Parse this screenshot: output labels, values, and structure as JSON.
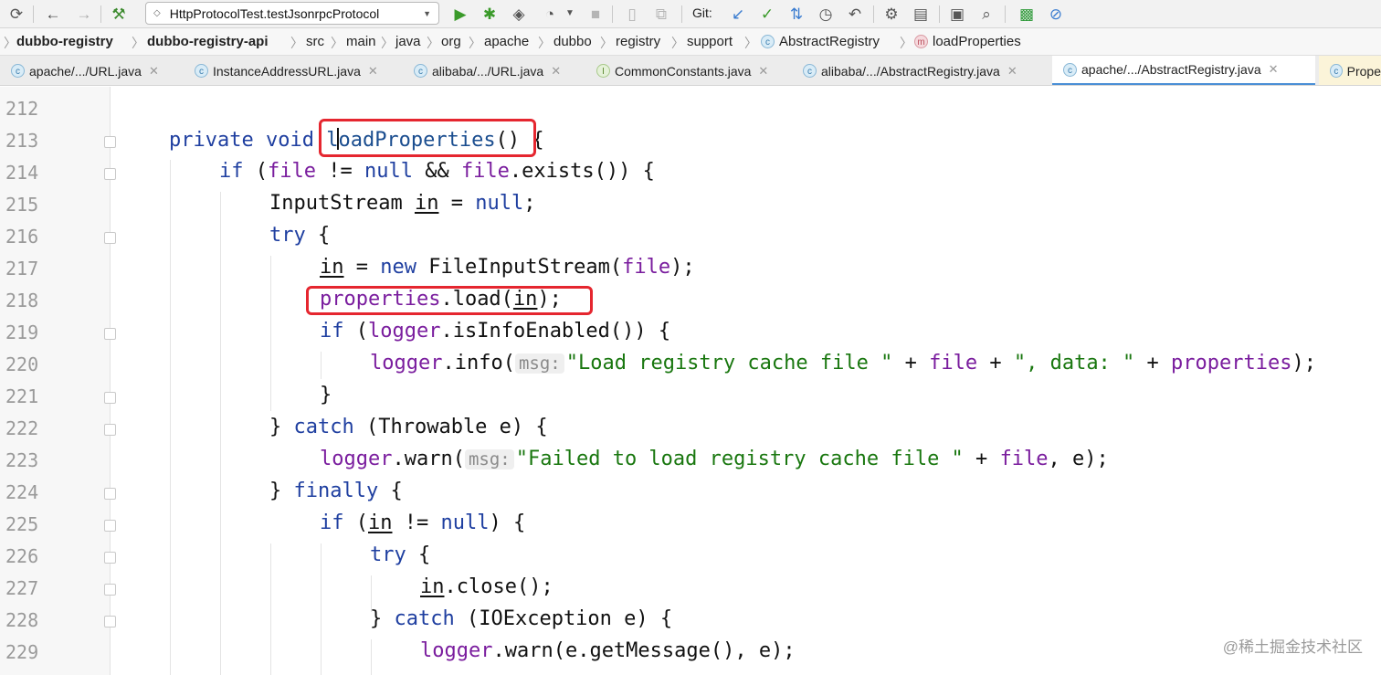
{
  "toolbar": {
    "run_config": "HttpProtocolTest.testJsonrpcProtocol",
    "git_label": "Git:"
  },
  "breadcrumb": {
    "items": [
      "dubbo-registry",
      "dubbo-registry-api",
      "src",
      "main",
      "java",
      "org",
      "apache",
      "dubbo",
      "registry",
      "support",
      "AbstractRegistry",
      "loadProperties"
    ]
  },
  "tabs": [
    {
      "label": "apache/.../URL.java",
      "icon": "c"
    },
    {
      "label": "InstanceAddressURL.java",
      "icon": "c"
    },
    {
      "label": "alibaba/.../URL.java",
      "icon": "c"
    },
    {
      "label": "CommonConstants.java",
      "icon": "i"
    },
    {
      "label": "alibaba/.../AbstractRegistry.java",
      "icon": "c"
    },
    {
      "label": "apache/.../AbstractRegistry.java",
      "icon": "c"
    },
    {
      "label": "Prope",
      "icon": "c"
    }
  ],
  "editor": {
    "line_numbers": [
      "212",
      "213",
      "214",
      "215",
      "216",
      "217",
      "218",
      "219",
      "220",
      "221",
      "222",
      "223",
      "224",
      "225",
      "226",
      "227",
      "228",
      "229"
    ],
    "hint_msg": "msg:",
    "tokens": {
      "private": "private",
      "void": "void",
      "method": "loadProperties",
      "method_tail": "()",
      "open_brace": " {",
      "if": "if",
      "file": "file",
      "neq_null": " != ",
      "null": "null",
      "and": " && ",
      "exists": ".exists()) {",
      "inputstream": "InputStream ",
      "in": "in",
      "eq": " = ",
      "semicolon": ";",
      "try": "try",
      "brace_open": " {",
      "new": "new",
      "fis": " FileInputStream(",
      "close_paren_semi": ");",
      "properties": "properties",
      "load": ".load(",
      "logger": "logger",
      "isinfo": ".isInfoEnabled()) {",
      "info": ".info(",
      "str_load": "\"Load registry cache file \"",
      "plus": " + ",
      "str_data": "\", data: \"",
      "rbrace": "}",
      "catch": "catch",
      "throwable": " (Throwable e) {",
      "warn": ".warn(",
      "str_failed": "\"Failed to load registry cache file \"",
      "comma_e": ", e);",
      "finally": "finally",
      "paren_open": " (",
      "in_close": ") {",
      "close_call": ".close();",
      "ioexc": " (IOException e) {",
      "getmsg": ".warn(e.getMessage(), e);"
    }
  },
  "watermark": "@稀土掘金技术社区"
}
